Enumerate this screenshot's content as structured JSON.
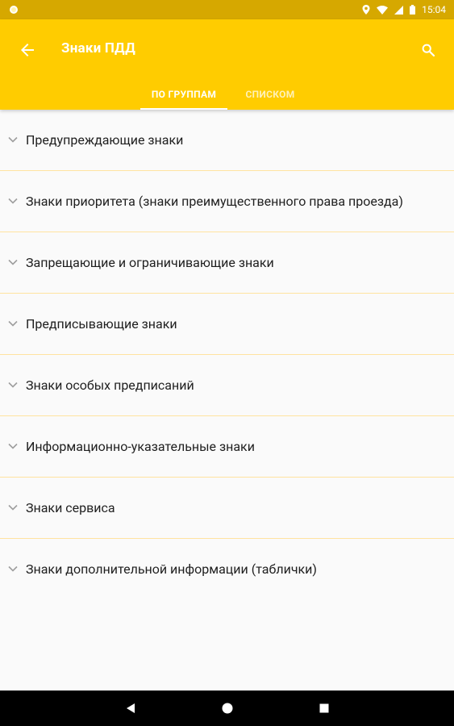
{
  "status_bar": {
    "time": "15:04",
    "icons": [
      "location-icon",
      "wifi-icon",
      "signal-icon",
      "battery-icon"
    ]
  },
  "app_bar": {
    "title": "Знаки ПДД",
    "back_icon": "arrow-left-icon",
    "search_icon": "search-icon",
    "background_color": "#ffcc00"
  },
  "tabs": [
    {
      "label": "ПО ГРУППАМ",
      "active": true
    },
    {
      "label": "СПИСКОМ",
      "active": false
    }
  ],
  "groups": [
    {
      "label": "Предупреждающие знаки"
    },
    {
      "label": "Знаки приоритета (знаки преимущественного права проезда)"
    },
    {
      "label": "Запрещающие и ограничивающие знаки"
    },
    {
      "label": "Предписывающие знаки"
    },
    {
      "label": "Знаки особых предписаний"
    },
    {
      "label": "Информационно-указательные знаки"
    },
    {
      "label": "Знаки сервиса"
    },
    {
      "label": "Знаки дополнительной информации (таблички)"
    }
  ],
  "nav_bar": {
    "icons": [
      "back-triangle-icon",
      "home-circle-icon",
      "recents-square-icon"
    ]
  }
}
